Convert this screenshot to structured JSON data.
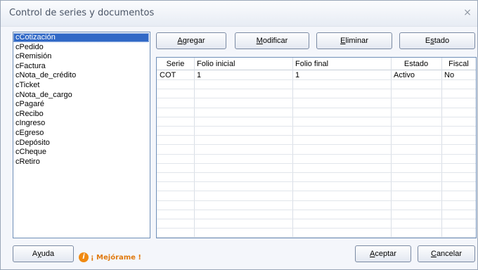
{
  "window": {
    "title": "Control de series y documentos",
    "close_glyph": "×"
  },
  "document_types": [
    {
      "label": "cCotización",
      "selected": true
    },
    {
      "label": "cPedido"
    },
    {
      "label": "cRemisión"
    },
    {
      "label": "cFactura"
    },
    {
      "label": "cNota_de_crédito"
    },
    {
      "label": "cTicket"
    },
    {
      "label": "cNota_de_cargo"
    },
    {
      "label": "cPagaré"
    },
    {
      "label": "cRecibo"
    },
    {
      "label": "cIngreso"
    },
    {
      "label": "cEgreso"
    },
    {
      "label": "cDepósito"
    },
    {
      "label": "cCheque"
    },
    {
      "label": "cRetiro"
    }
  ],
  "toolbar": {
    "agregar": {
      "mnemonic": "A",
      "rest": "gregar"
    },
    "modificar": {
      "mnemonic": "M",
      "rest": "odificar"
    },
    "eliminar": {
      "mnemonic": "E",
      "rest": "liminar"
    },
    "estado": {
      "pre": "E",
      "mnemonic": "s",
      "rest": "tado"
    }
  },
  "series_table": {
    "columns": [
      "Serie",
      "Folio inicial",
      "Folio final",
      "Estado",
      "Fiscal"
    ],
    "rows": [
      [
        "COT",
        "1",
        "1",
        "Activo",
        "No"
      ]
    ]
  },
  "footer": {
    "ayuda": {
      "pre": "A",
      "mnemonic": "y",
      "rest": "uda"
    },
    "brand_text": "¡ Mejórame !",
    "brand_icon": "i",
    "aceptar": {
      "mnemonic": "A",
      "rest": "ceptar"
    },
    "cancelar": {
      "mnemonic": "C",
      "rest": "ancelar"
    }
  },
  "colors": {
    "selection": "#3169c6",
    "brand": "#f08a12"
  }
}
